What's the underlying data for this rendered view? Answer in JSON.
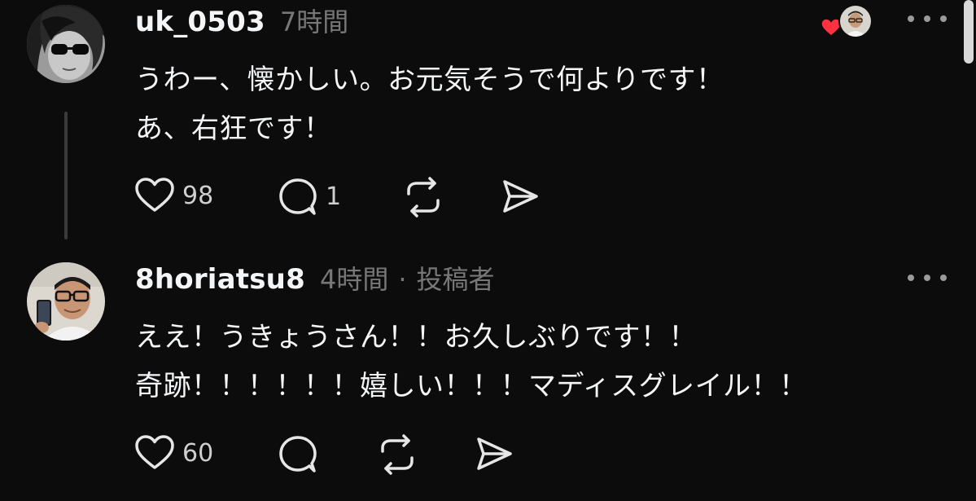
{
  "comments": [
    {
      "username": "uk_0503",
      "timestamp": "7時間",
      "lines": [
        "うわー、懐かしい。お元気そうで何よりです！",
        "あ、右狂です！"
      ],
      "likes": "98",
      "replies": "1"
    },
    {
      "username": "8horiatsu8",
      "timestamp": "4時間",
      "separator": "·",
      "author_tag": "投稿者",
      "lines": [
        "ええ！うきょうさん！！お久しぶりです！！",
        "奇跡！！！！！！嬉しい！！！マディスグレイル！！"
      ],
      "likes": "60",
      "replies": ""
    }
  ],
  "icons": {
    "like": "heart-outline-icon",
    "reply": "speech-bubble-icon",
    "repost": "repost-arrows-icon",
    "share": "paper-plane-icon",
    "more": "more-dots-icon",
    "liked_by_author": "red-heart-icon"
  },
  "colors": {
    "background": "#0c0c0c",
    "text": "#f3f5f7",
    "muted": "#777777",
    "heart": "#ff3040"
  }
}
